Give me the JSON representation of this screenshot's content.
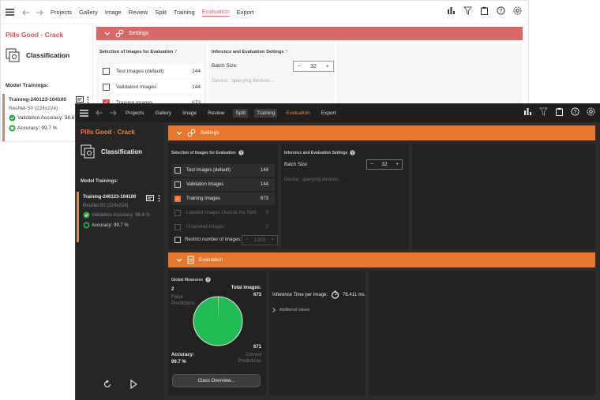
{
  "nav": [
    "Projects",
    "Gallery",
    "Image",
    "Review",
    "Split",
    "Training",
    "Evaluation",
    "Export"
  ],
  "active_nav": "Evaluation",
  "project_name": "Pills Good - Crack",
  "method": "Classification",
  "model_trainings_title": "Model Trainings:",
  "training": {
    "name": "Training-240123-104100",
    "model": "ResNet-50 (224x224)",
    "validation_accuracy": "Validation Accuracy: 98.6 %",
    "accuracy": "Accuracy: 99.7 %"
  },
  "settings": {
    "title": "Settings",
    "selection_title": "Selection of Images for Evaluation",
    "images": [
      {
        "label": "Test Images (default)",
        "count": "144",
        "checked": false,
        "enabled": true
      },
      {
        "label": "Validation Images",
        "count": "144",
        "checked": false,
        "enabled": true
      },
      {
        "label": "Training Images",
        "count": "673",
        "checked": true,
        "enabled": true
      },
      {
        "label": "Labeled Images Outside the Split",
        "count": "0",
        "checked": false,
        "enabled": false
      },
      {
        "label": "Unlabeled Images",
        "count": "0",
        "checked": false,
        "enabled": false
      }
    ],
    "restrict_label": "Restrict number of images:",
    "restrict_value": "1000",
    "inference_title": "Inference and Evaluation Settings",
    "batch_size_label": "Batch Size:",
    "batch_size": "32",
    "device_label": "Device:",
    "device_value": "querying devices..."
  },
  "evaluation": {
    "title": "Evaluation",
    "global_measures_title": "Global Measures",
    "false_count": "2",
    "false_label": "False Predictions",
    "total_label": "Total images:",
    "total_value": "673",
    "correct_count": "671",
    "correct_label": "Correct Predictions",
    "accuracy_label": "Accuracy:",
    "accuracy_value": "99.7 %",
    "class_overview_button": "Class Overview...",
    "inference_time_label": "Inference Time per Image:",
    "inference_time_value": "76.411 ms",
    "additional_values_label": "Additional Values"
  },
  "colors": {
    "light_accent": "#d9686a",
    "dark_accent": "#e8772f",
    "pie_correct": "#22bb55",
    "pie_false": "#e0e0e0"
  },
  "icons": [
    "menu-icon",
    "undo-icon",
    "redo-icon",
    "chart-icon",
    "filter-icon",
    "clipboard-icon",
    "help-icon",
    "gear-icon",
    "chevron-down-icon",
    "settings-icon",
    "evaluation-icon",
    "timer-icon",
    "refresh-icon",
    "play-icon"
  ]
}
